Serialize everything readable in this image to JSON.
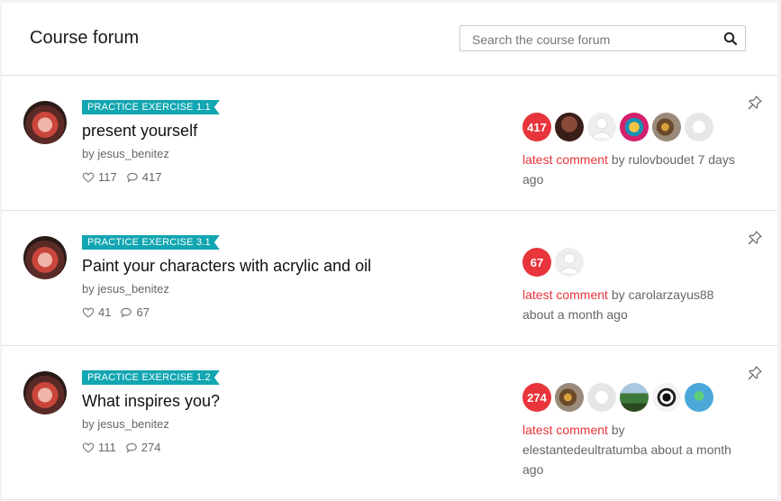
{
  "header": {
    "title": "Course forum",
    "search_placeholder": "Search the course forum"
  },
  "posts": [
    {
      "tag": "PRACTICE EXERCISE 1.1",
      "title": "present yourself",
      "author_prefix": "by",
      "author": "jesus_benitez",
      "likes": "117",
      "comments": "417",
      "reply_count": "417",
      "avatars": [
        "dark-red",
        "gray",
        "magenta-tiger",
        "tiger-eye",
        "gray-light"
      ],
      "latest_label": "latest comment",
      "latest_by": "by",
      "latest_user": "rulovboudet",
      "latest_time": "7 days ago"
    },
    {
      "tag": "PRACTICE EXERCISE 3.1",
      "title": "Paint your characters with acrylic and oil",
      "author_prefix": "by",
      "author": "jesus_benitez",
      "likes": "41",
      "comments": "67",
      "reply_count": "67",
      "avatars": [
        "gray"
      ],
      "latest_label": "latest comment",
      "latest_by": "by",
      "latest_user": "carolarzayus88",
      "latest_time": "about a month ago"
    },
    {
      "tag": "PRACTICE EXERCISE 1.2",
      "title": "What inspires you?",
      "author_prefix": "by",
      "author": "jesus_benitez",
      "likes": "111",
      "comments": "274",
      "reply_count": "274",
      "avatars": [
        "tiger-eye",
        "gray-light",
        "landscape",
        "dragon",
        "blue-green"
      ],
      "latest_label": "latest comment",
      "latest_by": "by",
      "latest_user": "elestantedeultratumba",
      "latest_time": "about a month ago"
    }
  ],
  "colors": {
    "accent_red": "#e8343b",
    "tag_teal": "#11a6b1"
  }
}
